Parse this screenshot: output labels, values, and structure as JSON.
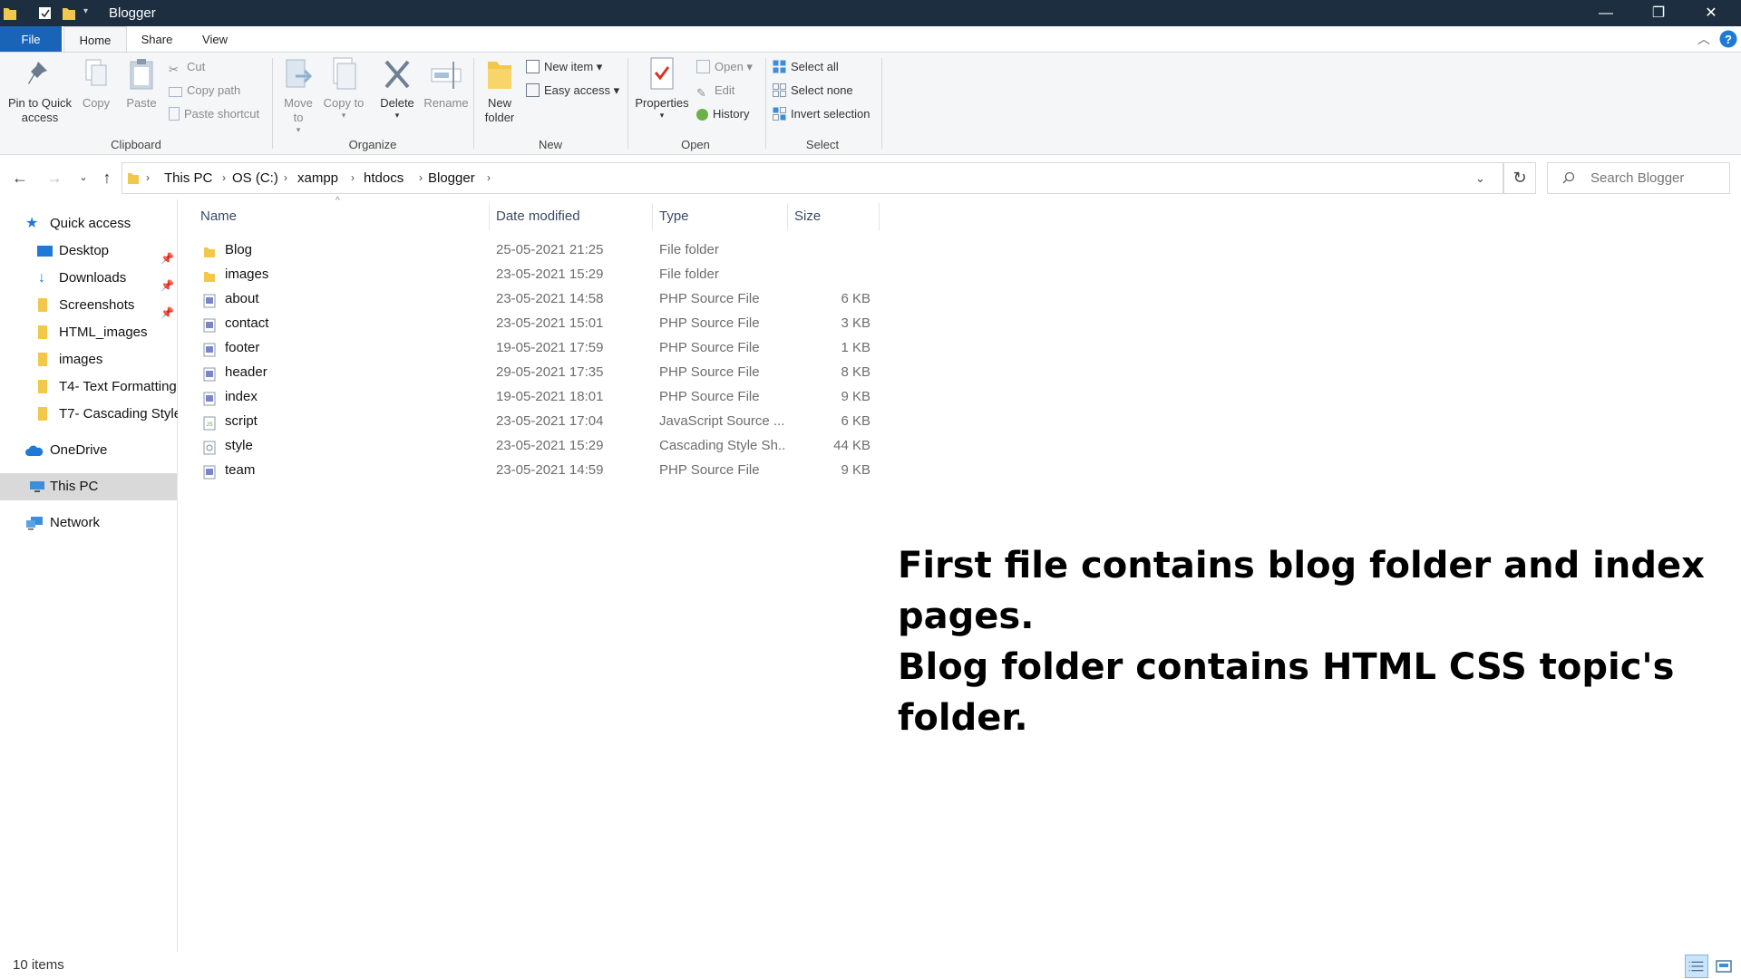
{
  "window": {
    "title": "Blogger",
    "minimize_icon": "minimize-icon",
    "maximize_icon": "restore-icon",
    "close_icon": "close-icon"
  },
  "tabs": [
    {
      "label": "File"
    },
    {
      "label": "Home"
    },
    {
      "label": "Share"
    },
    {
      "label": "View"
    }
  ],
  "ribbon": {
    "clipboard": {
      "group_label": "Clipboard",
      "pin_label": "Pin to Quick access",
      "copy_label": "Copy",
      "paste_label": "Paste",
      "cut_label": "Cut",
      "copy_path_label": "Copy path",
      "paste_shortcut_label": "Paste shortcut"
    },
    "organize": {
      "group_label": "Organize",
      "move_to_label": "Move to",
      "copy_to_label": "Copy to",
      "delete_label": "Delete",
      "rename_label": "Rename"
    },
    "new": {
      "group_label": "New",
      "new_folder_label": "New folder",
      "new_item_label": "New item",
      "easy_access_label": "Easy access"
    },
    "open": {
      "group_label": "Open",
      "properties_label": "Properties",
      "open_label": "Open",
      "edit_label": "Edit",
      "history_label": "History"
    },
    "select": {
      "group_label": "Select",
      "select_all_label": "Select all",
      "select_none_label": "Select none",
      "invert_selection_label": "Invert selection"
    }
  },
  "address": {
    "crumbs": [
      "This PC",
      "OS (C:)",
      "xampp",
      "htdocs",
      "Blogger"
    ]
  },
  "search": {
    "placeholder": "Search Blogger"
  },
  "nav": {
    "quick_access": "Quick access",
    "items": [
      {
        "label": "Desktop",
        "pinned": true
      },
      {
        "label": "Downloads",
        "pinned": true
      },
      {
        "label": "Screenshots",
        "pinned": true
      },
      {
        "label": "HTML_images",
        "pinned": false
      },
      {
        "label": "images",
        "pinned": false
      },
      {
        "label": "T4- Text Formatting",
        "pinned": false
      },
      {
        "label": "T7- Cascading Style",
        "pinned": false
      }
    ],
    "onedrive": "OneDrive",
    "this_pc": "This PC",
    "network": "Network"
  },
  "columns": {
    "name": "Name",
    "date": "Date modified",
    "type": "Type",
    "size": "Size"
  },
  "files": [
    {
      "name": "Blog",
      "date": "25-05-2021 21:25",
      "type": "File folder",
      "size": "",
      "icon": "folder-icon"
    },
    {
      "name": "images",
      "date": "23-05-2021 15:29",
      "type": "File folder",
      "size": "",
      "icon": "folder-icon"
    },
    {
      "name": "about",
      "date": "23-05-2021 14:58",
      "type": "PHP Source File",
      "size": "6 KB",
      "icon": "php-file-icon"
    },
    {
      "name": "contact",
      "date": "23-05-2021 15:01",
      "type": "PHP Source File",
      "size": "3 KB",
      "icon": "php-file-icon"
    },
    {
      "name": "footer",
      "date": "19-05-2021 17:59",
      "type": "PHP Source File",
      "size": "1 KB",
      "icon": "php-file-icon"
    },
    {
      "name": "header",
      "date": "29-05-2021 17:35",
      "type": "PHP Source File",
      "size": "8 KB",
      "icon": "php-file-icon"
    },
    {
      "name": "index",
      "date": "19-05-2021 18:01",
      "type": "PHP Source File",
      "size": "9 KB",
      "icon": "php-file-icon"
    },
    {
      "name": "script",
      "date": "23-05-2021 17:04",
      "type": "JavaScript Source ...",
      "size": "6 KB",
      "icon": "js-file-icon"
    },
    {
      "name": "style",
      "date": "23-05-2021 15:29",
      "type": "Cascading Style Sh...",
      "size": "44 KB",
      "icon": "css-file-icon"
    },
    {
      "name": "team",
      "date": "23-05-2021 14:59",
      "type": "PHP Source File",
      "size": "9 KB",
      "icon": "php-file-icon"
    }
  ],
  "annotation": {
    "line1": "First file contains blog folder and index pages.",
    "line2": "Blog folder contains HTML CSS topic's folder."
  },
  "status": {
    "item_count": "10 items"
  },
  "colors": {
    "titlebar": "#1c2e40",
    "file_tab": "#1a64b8",
    "selected_nav": "#cce4f7",
    "folder": "#f2c84b",
    "accent_blue": "#1e90e0"
  }
}
